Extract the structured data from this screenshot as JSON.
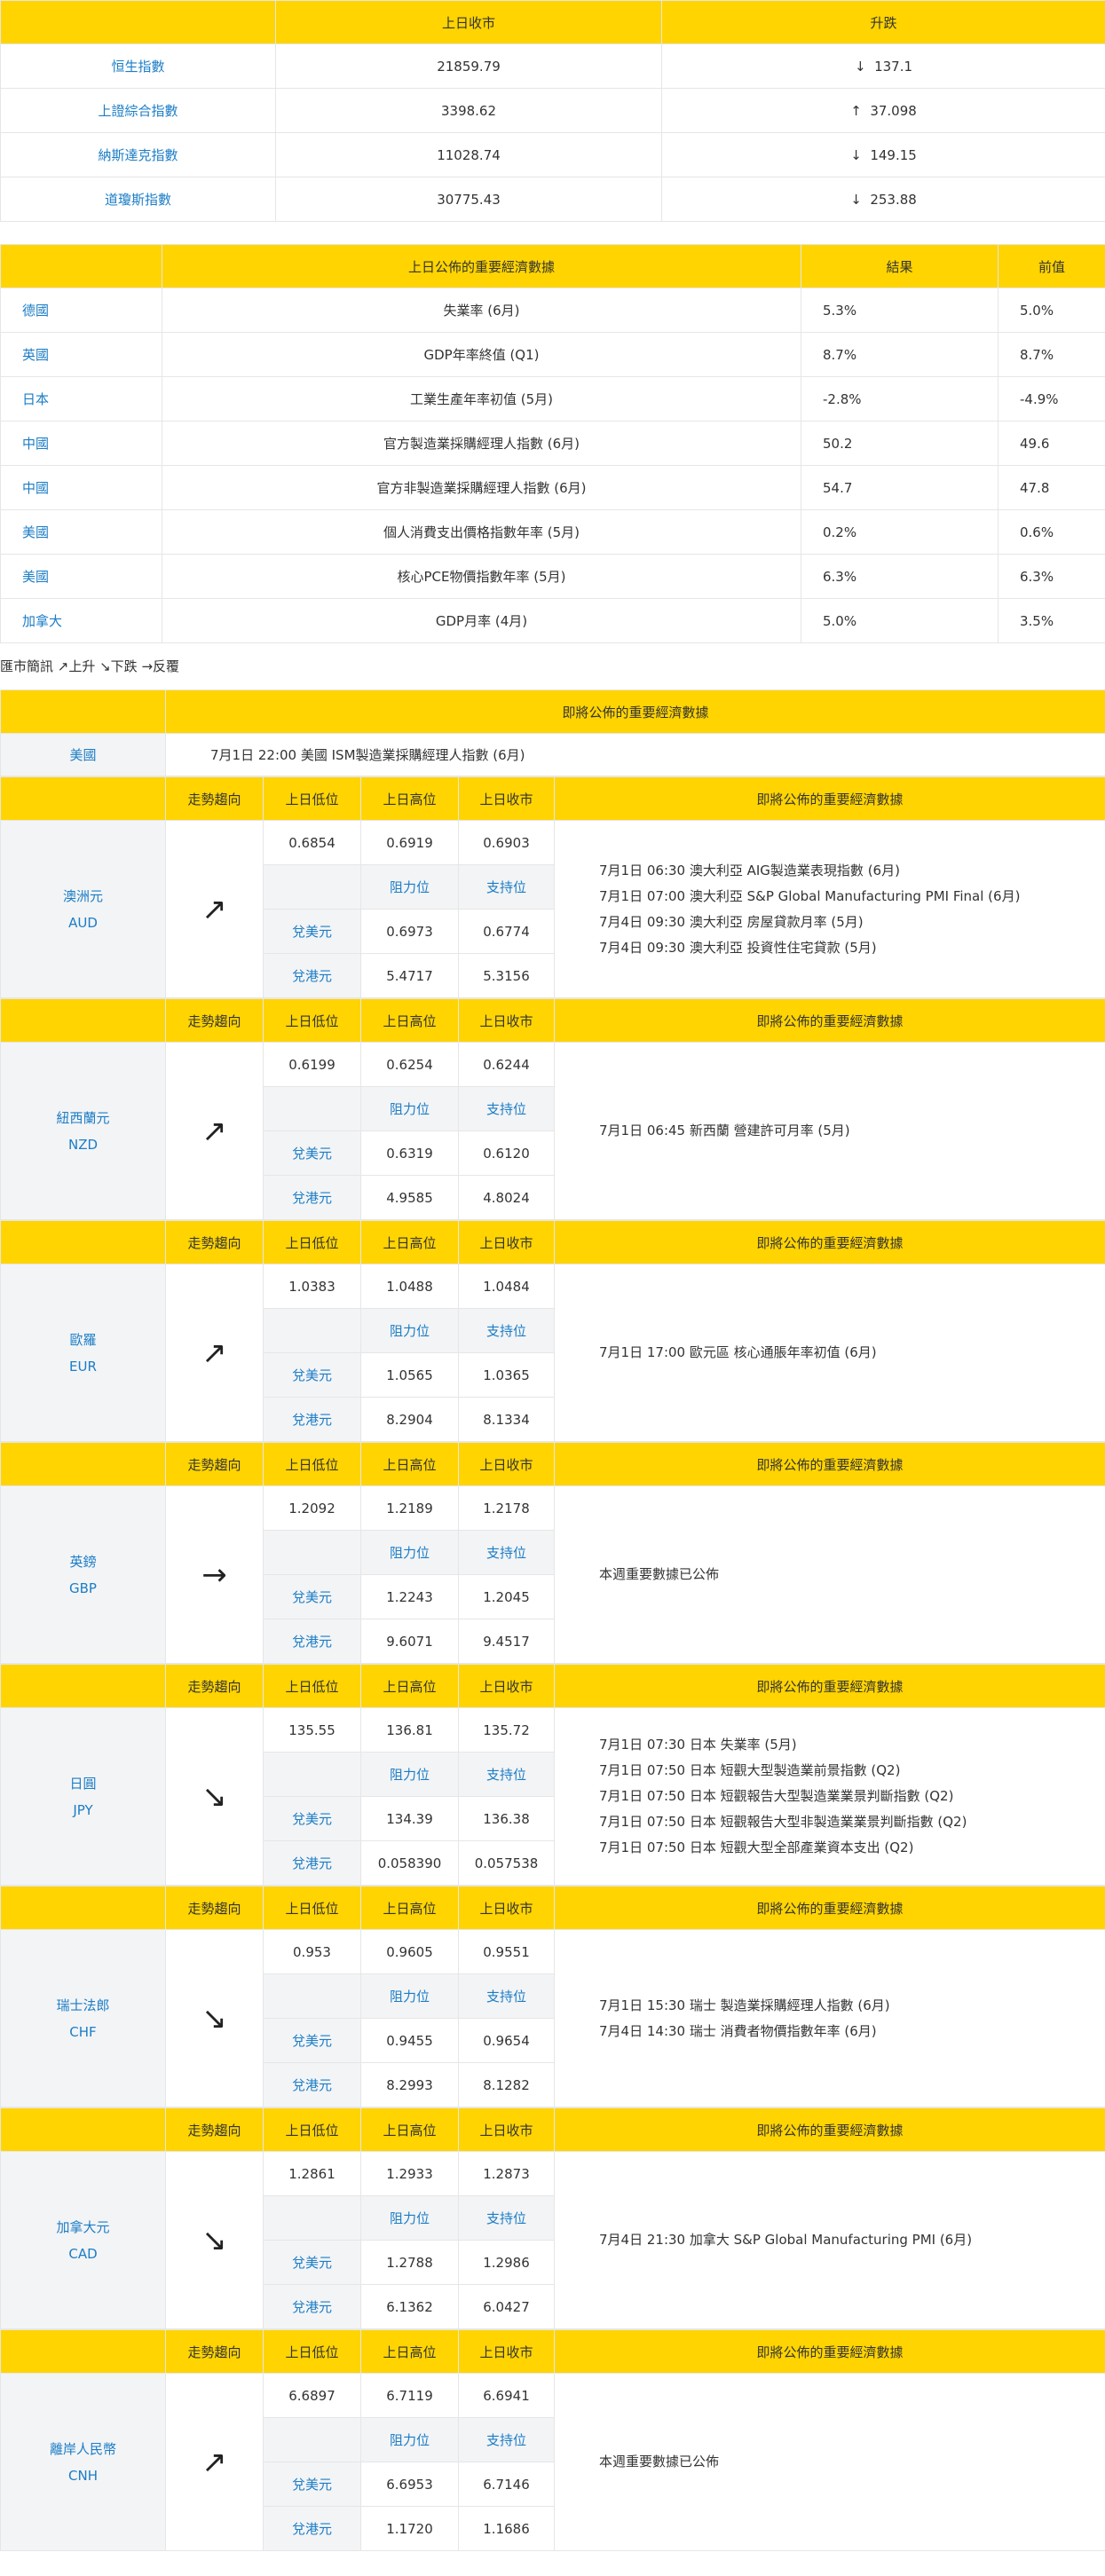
{
  "indices": {
    "headers": [
      "",
      "上日收市",
      "升跌"
    ],
    "rows": [
      {
        "name": "恒生指數",
        "close": "21859.79",
        "arrow": "↓",
        "change": "137.1"
      },
      {
        "name": "上證綜合指數",
        "close": "3398.62",
        "arrow": "↑",
        "change": "37.098"
      },
      {
        "name": "納斯達克指數",
        "close": "11028.74",
        "arrow": "↓",
        "change": "149.15"
      },
      {
        "name": "道瓊斯指數",
        "close": "30775.43",
        "arrow": "↓",
        "change": "253.88"
      }
    ]
  },
  "released": {
    "headers": [
      "",
      "上日公佈的重要經濟數據",
      "結果",
      "前值"
    ],
    "rows": [
      {
        "country": "德國",
        "item": "失業率 (6月)",
        "result": "5.3%",
        "prev": "5.0%"
      },
      {
        "country": "英國",
        "item": "GDP年率終值 (Q1)",
        "result": "8.7%",
        "prev": "8.7%"
      },
      {
        "country": "日本",
        "item": "工業生產年率初值 (5月)",
        "result": "-2.8%",
        "prev": "-4.9%"
      },
      {
        "country": "中國",
        "item": "官方製造業採購經理人指數 (6月)",
        "result": "50.2",
        "prev": "49.6"
      },
      {
        "country": "中國",
        "item": "官方非製造業採購經理人指數 (6月)",
        "result": "54.7",
        "prev": "47.8"
      },
      {
        "country": "美國",
        "item": "個人消費支出價格指數年率 (5月)",
        "result": "0.2%",
        "prev": "0.6%"
      },
      {
        "country": "美國",
        "item": "核心PCE物價指數年率 (5月)",
        "result": "6.3%",
        "prev": "6.3%"
      },
      {
        "country": "加拿大",
        "item": "GDP月率 (4月)",
        "result": "5.0%",
        "prev": "3.5%"
      }
    ]
  },
  "legend": "匯市簡訊 ↗上升 ↘下跌 →反覆",
  "upcoming": {
    "header": "即將公佈的重要經濟數據",
    "country": "美國",
    "event": "7月1日 22:00 美國 ISM製造業採購經理人指數 (6月)"
  },
  "currency_headers": {
    "trend": "走勢趨向",
    "low": "上日低位",
    "high": "上日高位",
    "close": "上日收市",
    "events": "即將公佈的重要經濟數據",
    "resistance": "阻力位",
    "support": "支持位",
    "usd": "兌美元",
    "hkd": "兌港元"
  },
  "currencies": [
    {
      "name": "澳洲元",
      "code": "AUD",
      "trend": "↗",
      "low": "0.6854",
      "high": "0.6919",
      "close": "0.6903",
      "usd_res": "0.6973",
      "usd_sup": "0.6774",
      "hkd_res": "5.4717",
      "hkd_sup": "5.3156",
      "events": [
        "7月1日 06:30 澳大利亞 AIG製造業表現指數 (6月)",
        "7月1日 07:00 澳大利亞 S&P Global Manufacturing PMI Final (6月)",
        "7月4日 09:30 澳大利亞 房屋貸款月率 (5月)",
        "7月4日 09:30 澳大利亞 投資性住宅貸款 (5月)"
      ]
    },
    {
      "name": "紐西蘭元",
      "code": "NZD",
      "trend": "↗",
      "low": "0.6199",
      "high": "0.6254",
      "close": "0.6244",
      "usd_res": "0.6319",
      "usd_sup": "0.6120",
      "hkd_res": "4.9585",
      "hkd_sup": "4.8024",
      "events": [
        "7月1日 06:45 新西蘭 營建許可月率 (5月)"
      ]
    },
    {
      "name": "歐羅",
      "code": "EUR",
      "trend": "↗",
      "low": "1.0383",
      "high": "1.0488",
      "close": "1.0484",
      "usd_res": "1.0565",
      "usd_sup": "1.0365",
      "hkd_res": "8.2904",
      "hkd_sup": "8.1334",
      "events": [
        "7月1日 17:00 歐元區 核心通脹年率初值 (6月)"
      ]
    },
    {
      "name": "英鎊",
      "code": "GBP",
      "trend": "→",
      "low": "1.2092",
      "high": "1.2189",
      "close": "1.2178",
      "usd_res": "1.2243",
      "usd_sup": "1.2045",
      "hkd_res": "9.6071",
      "hkd_sup": "9.4517",
      "events": [
        "本週重要數據已公佈"
      ]
    },
    {
      "name": "日圓",
      "code": "JPY",
      "trend": "↘",
      "low": "135.55",
      "high": "136.81",
      "close": "135.72",
      "usd_res": "134.39",
      "usd_sup": "136.38",
      "hkd_res": "0.058390",
      "hkd_sup": "0.057538",
      "events": [
        "7月1日 07:30 日本 失業率 (5月)",
        "7月1日 07:50 日本     短觀大型製造業前景指數 (Q2)",
        "7月1日 07:50 日本 短觀報告大型製造業業景判斷指數 (Q2)",
        "7月1日 07:50 日本 短觀報告大型非製造業業景判斷指數 (Q2)",
        "7月1日 07:50 日本 短觀大型全部產業資本支出 (Q2)"
      ]
    },
    {
      "name": "瑞士法郎",
      "code": "CHF",
      "trend": "↘",
      "low": "0.953",
      "high": "0.9605",
      "close": "0.9551",
      "usd_res": "0.9455",
      "usd_sup": "0.9654",
      "hkd_res": "8.2993",
      "hkd_sup": "8.1282",
      "events": [
        "7月1日 15:30 瑞士 製造業採購經理人指數 (6月)",
        "7月4日 14:30 瑞士 消費者物價指數年率 (6月)"
      ]
    },
    {
      "name": "加拿大元",
      "code": "CAD",
      "trend": "↘",
      "low": "1.2861",
      "high": "1.2933",
      "close": "1.2873",
      "usd_res": "1.2788",
      "usd_sup": "1.2986",
      "hkd_res": "6.1362",
      "hkd_sup": "6.0427",
      "events": [
        "7月4日 21:30 加拿大 S&P Global Manufacturing PMI (6月)"
      ]
    },
    {
      "name": "離岸人民幣",
      "code": "CNH",
      "trend": "↗",
      "low": "6.6897",
      "high": "6.7119",
      "close": "6.6941",
      "usd_res": "6.6953",
      "usd_sup": "6.7146",
      "hkd_res": "1.1720",
      "hkd_sup": "1.1686",
      "events": [
        "本週重要數據已公佈"
      ]
    }
  ],
  "colors": {
    "header": "#ffd400",
    "link": "#1b7dc6",
    "label_bg": "#f3f4f6"
  }
}
